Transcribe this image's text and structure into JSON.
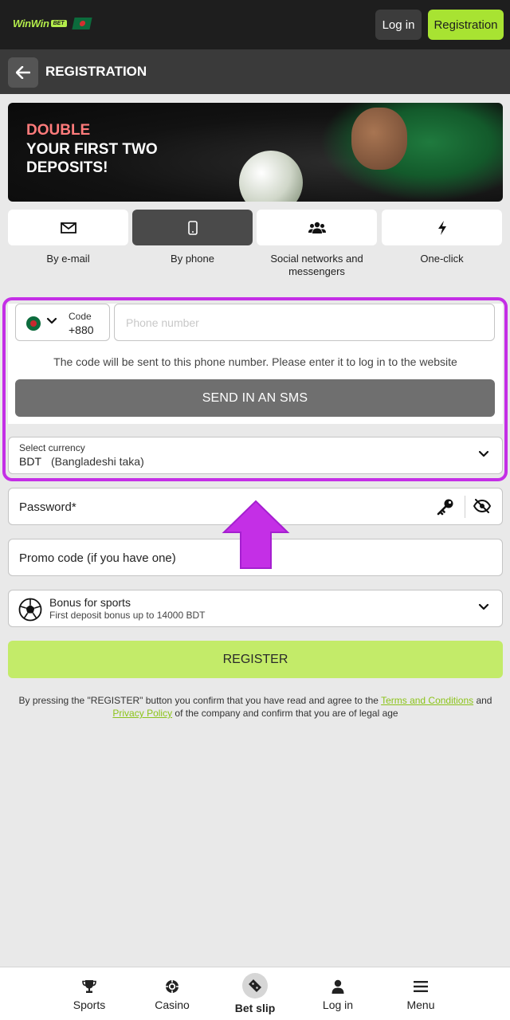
{
  "header": {
    "logo_text": "WinWin",
    "logo_badge": "BET",
    "login_label": "Log in",
    "register_label": "Registration"
  },
  "subheader": {
    "title": "REGISTRATION"
  },
  "banner": {
    "line1": "DOUBLE",
    "line2": "YOUR FIRST TWO DEPOSITS!"
  },
  "methods": [
    {
      "label": "By e-mail",
      "icon": "envelope-icon",
      "active": false
    },
    {
      "label": "By phone",
      "icon": "smartphone-icon",
      "active": true
    },
    {
      "label": "Social networks and messengers",
      "icon": "users-icon",
      "active": false
    },
    {
      "label": "One-click",
      "icon": "lightning-icon",
      "active": false
    }
  ],
  "phone": {
    "code_label": "Code",
    "code_value": "+880",
    "input_placeholder": "Phone number",
    "note": "The code will be sent to this phone number. Please enter it to log in to the website",
    "sms_button": "SEND IN AN SMS"
  },
  "currency": {
    "label": "Select currency",
    "code": "BDT",
    "name": "(Bangladeshi taka)"
  },
  "password": {
    "label": "Password*"
  },
  "promo": {
    "label": "Promo code (if you have one)"
  },
  "bonus": {
    "title": "Bonus for sports",
    "subtitle": "First deposit bonus up to 14000 BDT"
  },
  "register_button": "REGISTER",
  "terms": {
    "before": "By pressing the \"REGISTER\" button you confirm that you have read and agree to the ",
    "link1": "Terms and Conditions",
    "middle": " and ",
    "link2": "Privacy Policy",
    "after": " of the company and confirm that you are of legal age"
  },
  "colors": {
    "accent_green": "#a8e332",
    "highlight_purple": "#c42fe6",
    "dark_header": "#1e1e1e"
  },
  "bottom_nav": [
    {
      "label": "Sports",
      "icon": "trophy-icon"
    },
    {
      "label": "Casino",
      "icon": "casino-chip-icon"
    },
    {
      "label": "Bet slip",
      "icon": "ticket-icon"
    },
    {
      "label": "Log in",
      "icon": "user-icon"
    },
    {
      "label": "Menu",
      "icon": "hamburger-icon"
    }
  ]
}
